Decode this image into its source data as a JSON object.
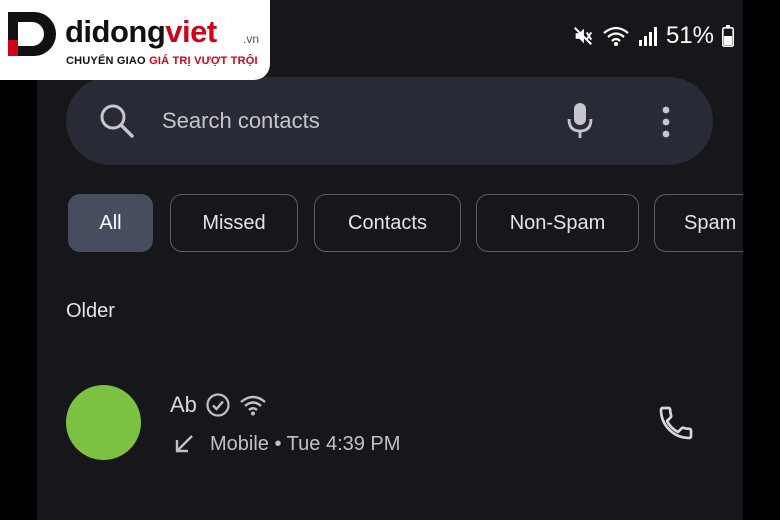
{
  "watermark": {
    "brand_dark": "didong",
    "brand_red": "viet",
    "brand_suffix": ".vn",
    "tagline_dark": "CHUYỂN GIAO ",
    "tagline_red": "GIÁ TRỊ VƯỢT TRỘI"
  },
  "status_bar": {
    "battery_percent": "51%",
    "icons": [
      "mute-icon",
      "wifi-icon",
      "signal-icon",
      "battery-icon"
    ]
  },
  "search": {
    "placeholder": "Search contacts",
    "icons": [
      "search-icon",
      "mic-icon",
      "more-vert-icon"
    ]
  },
  "filters": [
    {
      "label": "All",
      "active": true
    },
    {
      "label": "Missed",
      "active": false
    },
    {
      "label": "Contacts",
      "active": false
    },
    {
      "label": "Non-Spam",
      "active": false
    },
    {
      "label": "Spam",
      "active": false
    }
  ],
  "section_header": "Older",
  "calls": [
    {
      "name": "Ab",
      "avatar_color": "#7dc142",
      "type": "Mobile",
      "time": "Tue 4:39 PM",
      "detail": "Mobile • Tue 4:39 PM",
      "direction": "incoming",
      "icons": [
        "verified-icon",
        "wifi-calling-icon",
        "incoming-arrow-icon",
        "phone-icon"
      ]
    }
  ],
  "colors": {
    "background": "#17171b",
    "search_bg": "#282b35",
    "chip_active_bg": "#474d5e",
    "brand_red": "#d0021b"
  }
}
